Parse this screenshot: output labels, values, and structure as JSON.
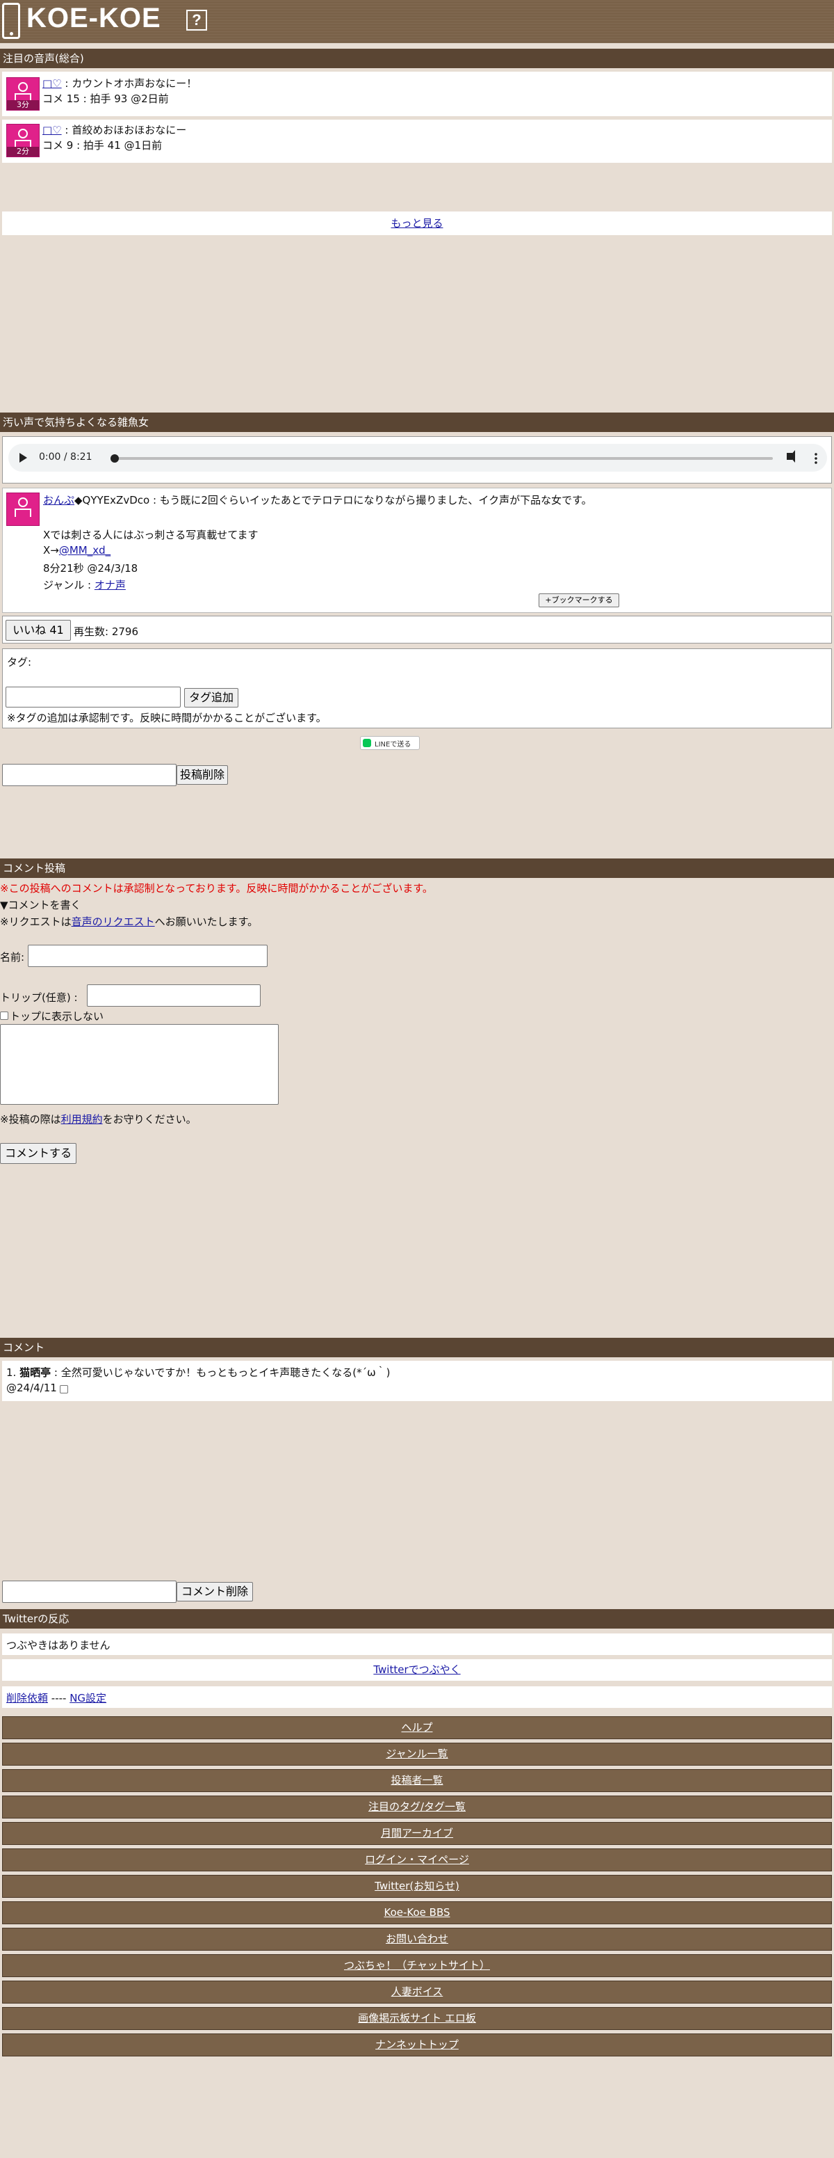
{
  "header": {
    "logo": "KOE-KOE",
    "help": "?"
  },
  "featured": {
    "title": "注目の音声(総合)",
    "items": [
      {
        "duration": "3分",
        "user": "□♡",
        "title": "カウントオホ声おなにー！",
        "stats": "コメ 15 : 拍手 93 @2日前"
      },
      {
        "duration": "2分",
        "user": "□♡",
        "title": "首絞めおほおほおなにー",
        "stats": "コメ 9 : 拍手 41 @1日前"
      }
    ],
    "more": "もっと見る"
  },
  "post": {
    "title": "汚い声で気持ちよくなる雑魚女",
    "audio_time": "0:00 / 8:21",
    "author": "おんぷ",
    "trip": "◆QYYExZvDco",
    "description": "もう既に2回ぐらいイッたあとでテロテロになりながら撮りました、イク声が下品な女です。",
    "line2": "Xでは刺さる人にはぶっ刺さる写真載せてます",
    "x_prefix": "X→",
    "x_handle": "@MM_xd_",
    "meta": "8分21秒 @24/3/18",
    "genre_label": "ジャンル : ",
    "genre": "オナ声",
    "bookmark": "+ブックマークする",
    "like": "いいね 41",
    "plays": "再生数: 2796"
  },
  "tags": {
    "label": "タグ:",
    "add": "タグ追加",
    "note": "※タグの追加は承認制です。反映に時間がかかることがございます。"
  },
  "line_share": "LINEで送る",
  "delete_post": "投稿削除",
  "comment_form": {
    "title": "コメント投稿",
    "warn": "※この投稿へのコメントは承認制となっております。反映に時間がかかることがございます。",
    "toggle": "▼コメントを書く",
    "request_pre": "※リクエストは",
    "request_link": "音声のリクエスト",
    "request_post": "へお願いいたします。",
    "name_label": "名前:",
    "trip_label": "トリップ(任意) :",
    "hide_label": "トップに表示しない",
    "rules_pre": "※投稿の際は",
    "rules_link": "利用規約",
    "rules_post": "をお守りください。",
    "submit": "コメントする"
  },
  "comments": {
    "title": "コメント",
    "items": [
      {
        "num": "1.",
        "author": "猫晒亭",
        "text": " : 全然可愛いじゃないですか！もっともっとイキ声聴きたくなる(*´ω｀)",
        "date": "@24/4/11"
      }
    ],
    "delete": "コメント削除"
  },
  "twitter": {
    "title": "Twitterの反応",
    "empty": "つぶやきはありません",
    "tweet": "Twitterでつぶやく"
  },
  "footer_links": {
    "delete_request": "削除依頼",
    "sep": " ---- ",
    "ng": "NG設定"
  },
  "menu": [
    "ヘルプ",
    "ジャンル一覧",
    "投稿者一覧",
    "注目のタグ/タグ一覧",
    "月間アーカイブ",
    "ログイン・マイページ",
    "Twitter(お知らせ)",
    "Koe-Koe BBS",
    "お問い合わせ",
    "つぶちゃ！（チャットサイト）",
    "人妻ボイス",
    "画像掲示板サイト エロ板",
    "ナンネットトップ"
  ]
}
